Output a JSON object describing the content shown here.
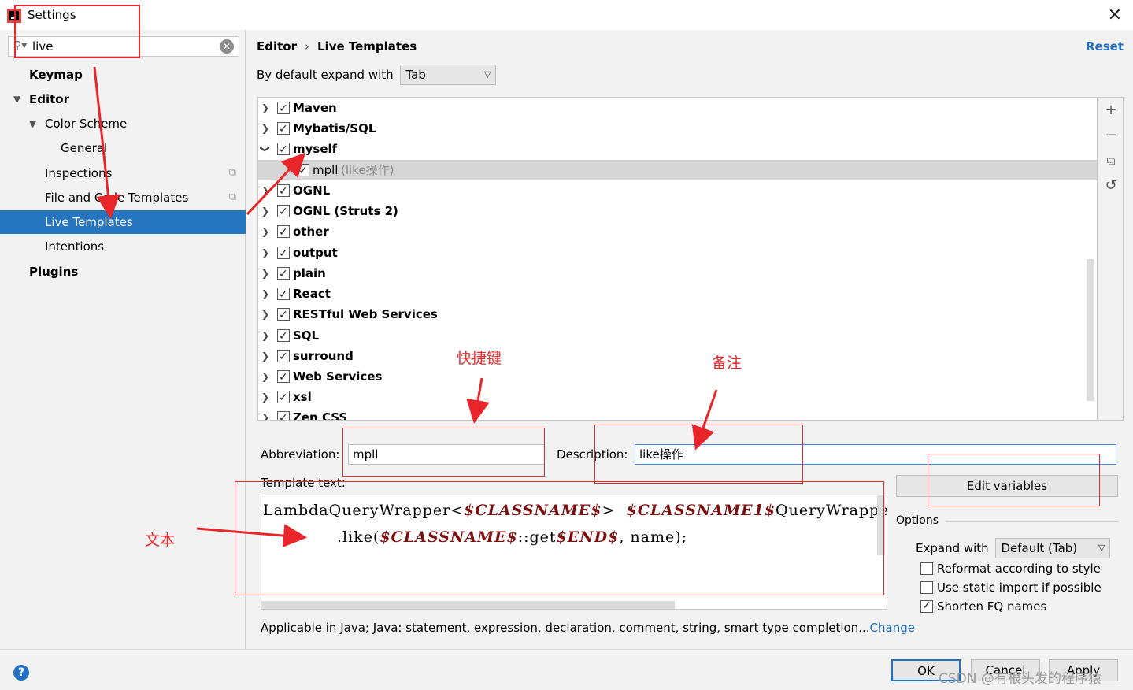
{
  "window": {
    "title": "Settings"
  },
  "search": {
    "value": "live"
  },
  "sidebar": {
    "items": [
      {
        "label": "Keymap"
      },
      {
        "label": "Editor"
      },
      {
        "label": "Color Scheme"
      },
      {
        "label": "General"
      },
      {
        "label": "Inspections"
      },
      {
        "label": "File and Code Templates"
      },
      {
        "label": "Live Templates"
      },
      {
        "label": "Intentions"
      },
      {
        "label": "Plugins"
      }
    ]
  },
  "header": {
    "breadcrumb": [
      "Editor",
      "Live Templates"
    ],
    "breadcrumb_sep": "›",
    "reset_label": "Reset",
    "expand_label": "By default expand with",
    "expand_value": "Tab"
  },
  "template_groups": [
    {
      "label": "Maven"
    },
    {
      "label": "Mybatis/SQL"
    },
    {
      "label": "myself"
    },
    {
      "label": "mpll",
      "desc": "(like操作)"
    },
    {
      "label": "OGNL"
    },
    {
      "label": "OGNL (Struts 2)"
    },
    {
      "label": "other"
    },
    {
      "label": "output"
    },
    {
      "label": "plain"
    },
    {
      "label": "React"
    },
    {
      "label": "RESTful Web Services"
    },
    {
      "label": "SQL"
    },
    {
      "label": "surround"
    },
    {
      "label": "Web Services"
    },
    {
      "label": "xsl"
    },
    {
      "label": "Zen CSS"
    }
  ],
  "editor": {
    "abbreviation_label": "Abbreviation:",
    "abbreviation_value": "mpll",
    "description_label": "Description:",
    "description_value": "like操作",
    "template_text_label": "Template text:",
    "code": {
      "l1a": "LambdaQueryWrapper<",
      "l1v1": "$CLASSNAME$",
      "l1b": "> ",
      "l1v2": "$CLASSNAME1$",
      "l1c": "QueryWrapper = Wrapper",
      "l2a": ".like(",
      "l2v1": "$CLASSNAME$",
      "l2b": "::get",
      "l2v2": "$END$",
      "l2c": ", name);"
    },
    "edit_variables_label": "Edit variables",
    "options_title": "Options",
    "expand_with_label": "Expand with",
    "expand_with_value": "Default (Tab)",
    "option_reformat": "Reformat according to style",
    "option_static_import": "Use static import if possible",
    "option_shorten_fq": "Shorten FQ names",
    "applicable_text": "Applicable in Java; Java: statement, expression, declaration, comment, string, smart type completion...",
    "change_label": "Change"
  },
  "footer": {
    "help": "?",
    "ok_label": "OK",
    "cancel_label": "Cancel",
    "apply_label": "Apply",
    "watermark": "CSDN @有根头发的程序猿"
  },
  "annotations": {
    "shortcut": "快捷键",
    "remark": "备注",
    "text": "文本"
  },
  "colors": {
    "selection": "#2675bf",
    "link": "#2470c4",
    "annotation": "#e8262a",
    "variable": "#7a0f0f"
  }
}
